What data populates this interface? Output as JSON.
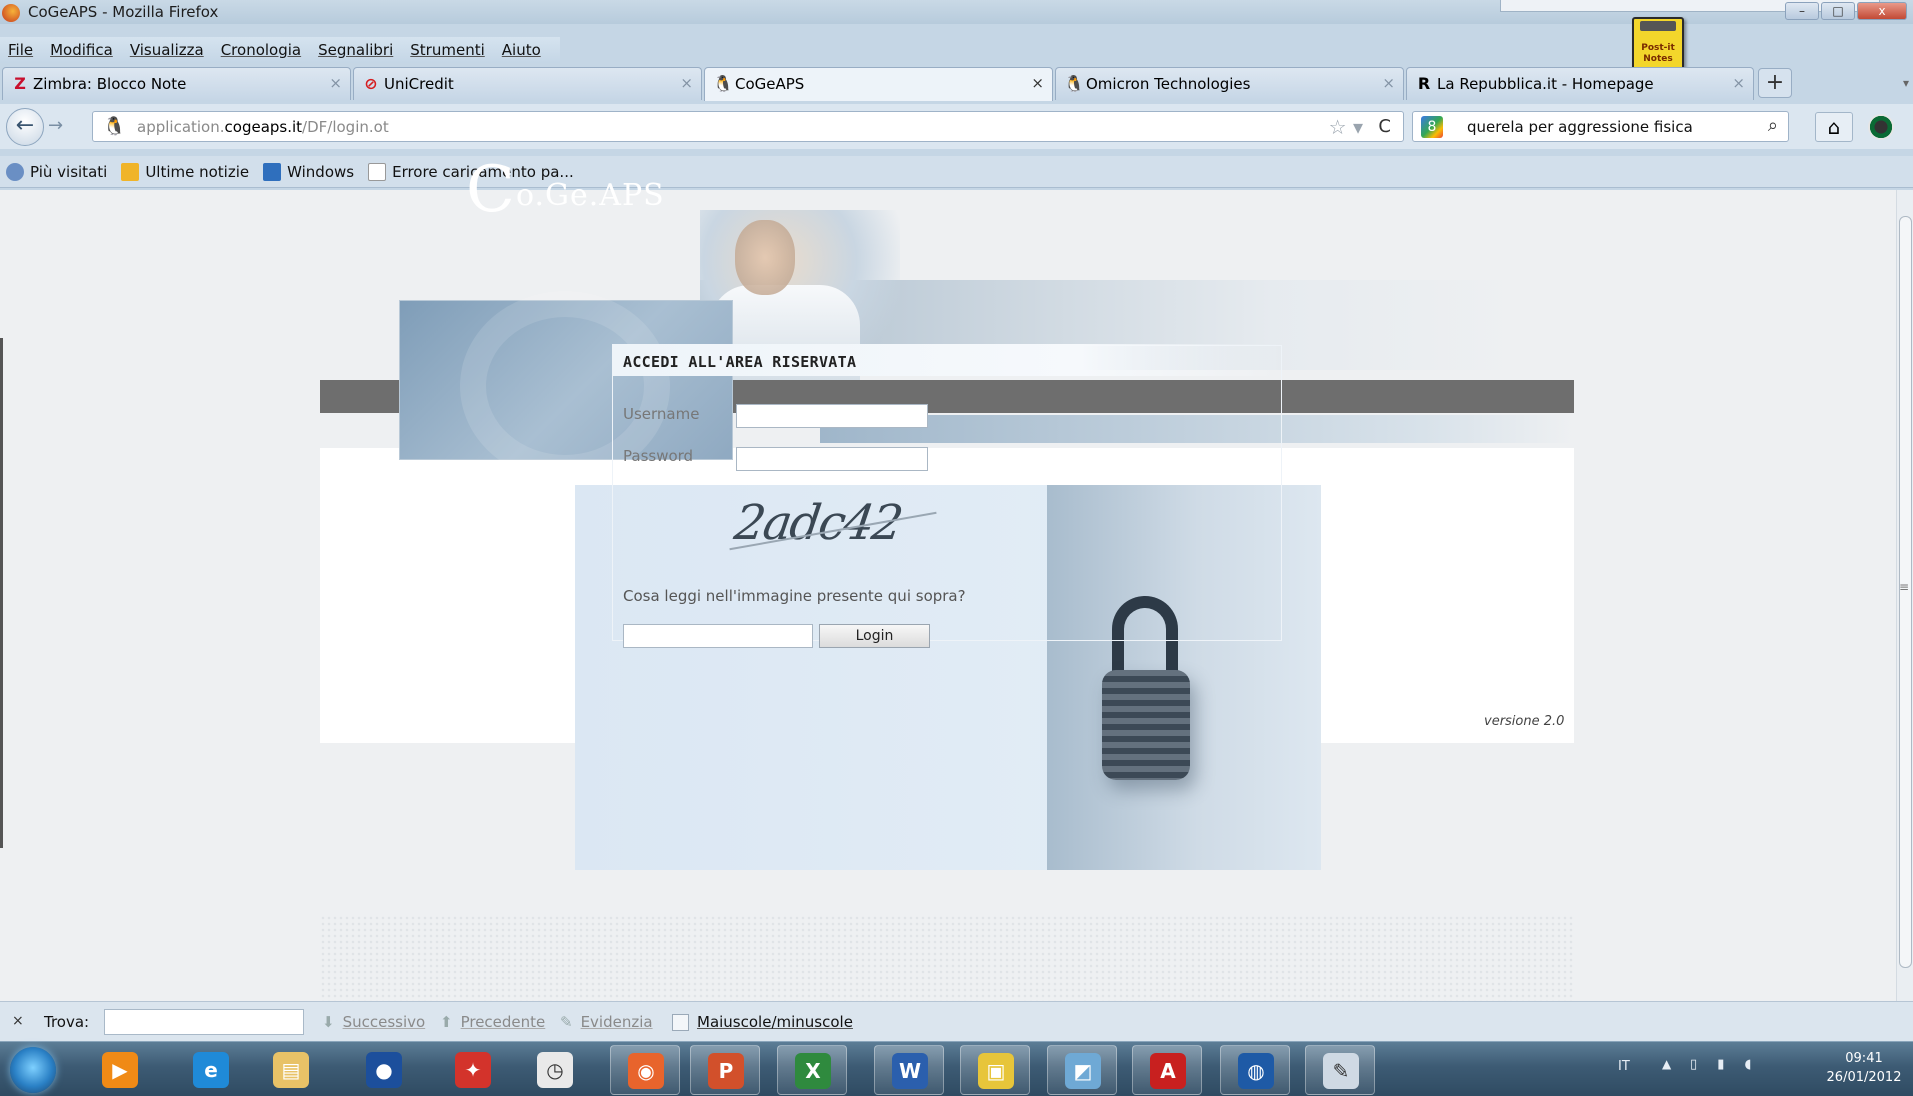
{
  "window": {
    "title": "CoGeAPS - Mozilla Firefox",
    "controls": {
      "minimize": "–",
      "maximize": "□",
      "close": "x"
    }
  },
  "menu": [
    "File",
    "Modifica",
    "Visualizza",
    "Cronologia",
    "Segnalibri",
    "Strumenti",
    "Aiuto"
  ],
  "tabs": [
    {
      "label": "Zimbra: Blocco Note",
      "icon": "Z",
      "icon_color": "#c8102e"
    },
    {
      "label": "UniCredit",
      "icon": "⊘",
      "icon_color": "#d51d20"
    },
    {
      "label": "CoGeAPS",
      "icon": "🐧",
      "icon_color": "#333333"
    },
    {
      "label": "Omicron Technologies",
      "icon": "🐧",
      "icon_color": "#333333"
    },
    {
      "label": "La Repubblica.it - Homepage",
      "icon": "R",
      "icon_color": "#000000"
    }
  ],
  "tab_close": "×",
  "new_tab": "+",
  "nav": {
    "back": "←",
    "forward": "→",
    "site_icon": "🐧",
    "url_prefix": "application.",
    "url_domain": "cogeaps.it",
    "url_path": "/DF/login.ot",
    "star": "☆ ▾",
    "reload": "C",
    "search_query": "querela per aggressione fisica",
    "search_engine_letter": "8",
    "search_glass": "⌕",
    "home": "⌂"
  },
  "bookmarks": [
    {
      "label": "Più visitati",
      "icon_color": "#6a8fc4"
    },
    {
      "label": "Ultime notizie",
      "icon_color": "#f0b429"
    },
    {
      "label": "Windows",
      "icon_color": "#2f6fbd"
    },
    {
      "label": "Errore caricamento pa...",
      "icon_color": "#ffffff"
    }
  ],
  "logo": {
    "initial": "C",
    "text": "o.Ge.APS"
  },
  "login": {
    "heading": "ACCEDI ALL'AREA RISERVATA",
    "username_label": "Username",
    "password_label": "Password",
    "username_value": "",
    "password_value": "",
    "captcha_text": "2adc42",
    "captcha_question": "Cosa leggi nell'immagine presente qui sopra?",
    "captcha_value": "",
    "login_button": "Login"
  },
  "version": "versione 2.0",
  "findbar": {
    "close": "×",
    "label": "Trova:",
    "value": "",
    "next": "Successivo",
    "previous": "Precedente",
    "highlight": "Evidenzia",
    "match_case": "Maiuscole/minuscole"
  },
  "taskbar": {
    "apps": [
      {
        "name": "media-player",
        "glyph": "▶",
        "color": "#f08a16"
      },
      {
        "name": "internet-explorer",
        "glyph": "e",
        "color": "#1f8ad8"
      },
      {
        "name": "file-explorer",
        "glyph": "▤",
        "color": "#e8c267"
      },
      {
        "name": "app-blue-circle",
        "glyph": "●",
        "color": "#1c4f9c"
      },
      {
        "name": "pin-app",
        "glyph": "✦",
        "color": "#d3332b"
      },
      {
        "name": "clock-app",
        "glyph": "◷",
        "color": "#e9e9e9"
      },
      {
        "name": "firefox",
        "glyph": "◉",
        "color": "#e8642c"
      },
      {
        "name": "powerpoint",
        "glyph": "P",
        "color": "#d2502b"
      },
      {
        "name": "excel",
        "glyph": "X",
        "color": "#2f8a3e"
      },
      {
        "name": "word",
        "glyph": "W",
        "color": "#2b5fad"
      },
      {
        "name": "post-it",
        "glyph": "▣",
        "color": "#e7c53a"
      },
      {
        "name": "remote-app",
        "glyph": "◩",
        "color": "#6fa9d5"
      },
      {
        "name": "acrobat",
        "glyph": "A",
        "color": "#c8201f"
      },
      {
        "name": "network-app",
        "glyph": "◍",
        "color": "#1e5aa6"
      },
      {
        "name": "paint",
        "glyph": "✎",
        "color": "#cfd9e4"
      }
    ],
    "language": "IT",
    "time": "09:41",
    "date": "26/01/2012"
  },
  "postit": {
    "label": "Post-it Notes"
  }
}
